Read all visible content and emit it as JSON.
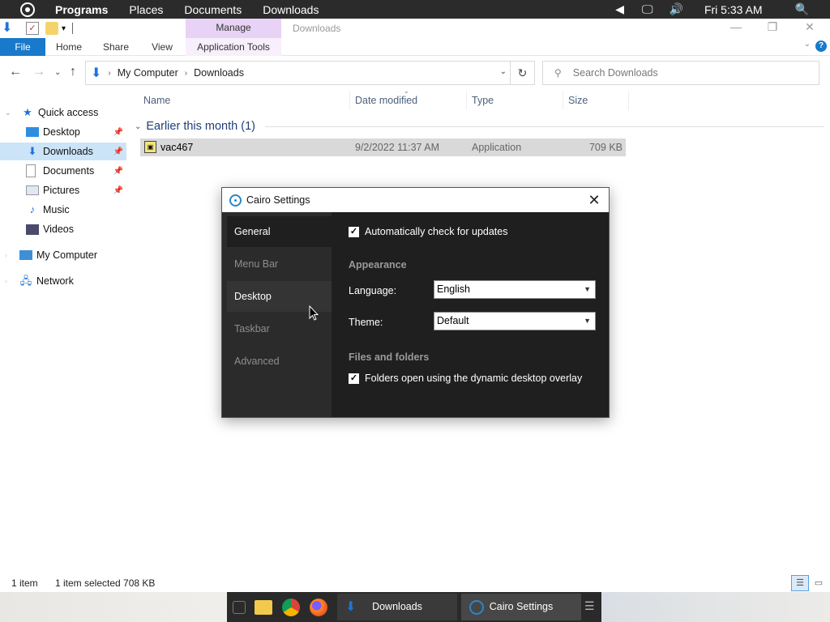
{
  "menubar": {
    "items": [
      "Programs",
      "Places",
      "Documents",
      "Downloads"
    ],
    "clock": "Fri 5:33 AM"
  },
  "explorer": {
    "context_tab": "Manage",
    "window_title": "Downloads",
    "tabs": {
      "file": "File",
      "home": "Home",
      "share": "Share",
      "view": "View",
      "app_tools": "Application Tools"
    },
    "address": {
      "root": "My Computer",
      "current": "Downloads"
    },
    "search_placeholder": "Search Downloads",
    "nav": {
      "quick_access": "Quick access",
      "desktop": "Desktop",
      "downloads": "Downloads",
      "documents": "Documents",
      "pictures": "Pictures",
      "music": "Music",
      "videos": "Videos",
      "my_computer": "My Computer",
      "network": "Network"
    },
    "columns": {
      "name": "Name",
      "date": "Date modified",
      "type": "Type",
      "size": "Size"
    },
    "group": "Earlier this month (1)",
    "file": {
      "name": "vac467",
      "date": "9/2/2022 11:37 AM",
      "type": "Application",
      "size": "709 KB"
    },
    "status": {
      "count": "1 item",
      "selected": "1 item selected  708 KB"
    }
  },
  "dialog": {
    "title": "Cairo Settings",
    "sidebar": [
      "General",
      "Menu Bar",
      "Desktop",
      "Taskbar",
      "Advanced"
    ],
    "auto_update": "Automatically check for updates",
    "appearance": "Appearance",
    "language_label": "Language:",
    "language_value": "English",
    "theme_label": "Theme:",
    "theme_value": "Default",
    "files_section": "Files and folders",
    "folders_overlay": "Folders open using the dynamic desktop overlay"
  },
  "taskbar": {
    "tasks": [
      "Downloads",
      "Cairo Settings"
    ]
  },
  "colors": {
    "accent": "#1979ca",
    "dialog_bg": "#1f1f1f",
    "dialog_sidebar": "#2b2b2b",
    "menubar": "#2b2b2b"
  }
}
